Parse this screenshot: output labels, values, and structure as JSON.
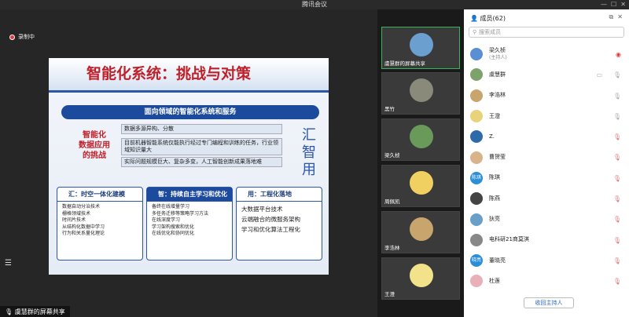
{
  "window": {
    "title": "腾讯会议"
  },
  "recording": {
    "label": "录制中"
  },
  "slide": {
    "title": "智能化系统：挑战与对策",
    "band": "面向领域的智能化系统和服务",
    "left_label": [
      "智能化",
      "数据应用",
      "的挑战"
    ],
    "items": [
      "数据多源异构、分散",
      "目前机器智能系统仅能执行经过专门编程和训练的任务，行业领域知识量大",
      "实际问题规模巨大、复杂多变，人工智能创新成果落地难"
    ],
    "vertical_text": [
      "汇",
      "智",
      "用"
    ],
    "columns": [
      {
        "header": "汇：时空一体化建模",
        "items": [
          "数据自动分治技术",
          "栅格领域技术",
          "时间片技术",
          "从结构化数据中学习",
          "行为和关系量化理论"
        ]
      },
      {
        "header": "智：持续自主学习和优化",
        "items": [
          "备终在线增量学习",
          "多任务迁移等策略学习方法",
          "在线深度学习",
          "学习架构搜索和优化",
          "在线优化和协同优化"
        ]
      },
      {
        "header": "用：工程化落地",
        "items": [
          "大数据平台技术",
          "云端融合的微服务架构",
          "学习和优化算法工程化"
        ]
      }
    ]
  },
  "share_label": "虞慧群的屏幕共享",
  "video_tiles": [
    {
      "name": "虞慧群的屏幕共享",
      "active": true
    },
    {
      "name": "黑竹"
    },
    {
      "name": "梁久桢"
    },
    {
      "name": "周佩凯"
    },
    {
      "name": "李浩林"
    },
    {
      "name": "王澄"
    }
  ],
  "members": {
    "header": "成员(62)",
    "search_placeholder": "搜索成员",
    "list": [
      {
        "name": "梁久桢",
        "sub": "(主持人)",
        "color": "#5a8fd4"
      },
      {
        "name": "虞慧群",
        "color": "#7da36b"
      },
      {
        "name": "李浩林",
        "color": "#c9a56e"
      },
      {
        "name": "王澄",
        "color": "#e8d27c"
      },
      {
        "name": "Z.",
        "color": "#2f6aa8"
      },
      {
        "name": "曹贺莹",
        "color": "#d9b48a"
      },
      {
        "name": "陈琪",
        "color": "#2a8fd8",
        "badge": "陈琪"
      },
      {
        "name": "陈燕",
        "color": "#444"
      },
      {
        "name": "狄亮",
        "color": "#6aa0c8"
      },
      {
        "name": "电科研21商莫淇",
        "color": "#888"
      },
      {
        "name": "董晓亮",
        "color": "#2a8fd8",
        "badge": "晓亮"
      },
      {
        "name": "杜莲",
        "color": "#e8b0b8"
      }
    ],
    "reclaim_host": "收回主持人"
  }
}
